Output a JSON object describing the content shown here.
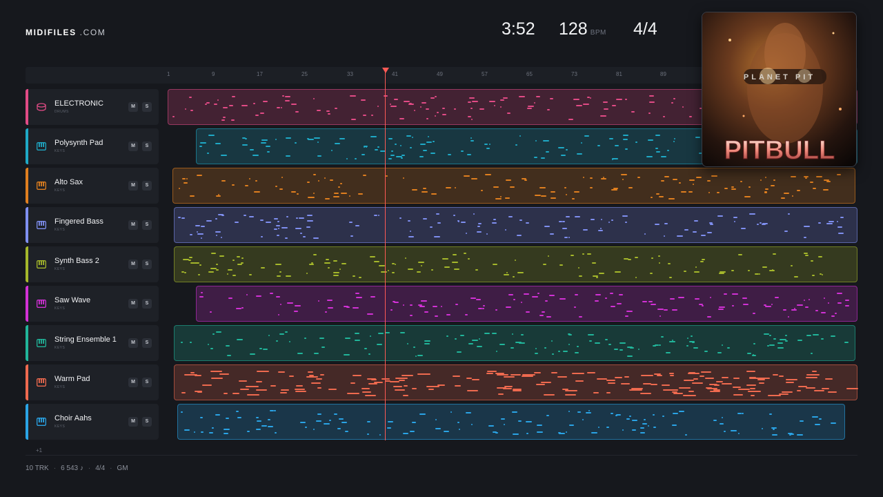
{
  "brand": {
    "name": "MIDIFILES",
    "suffix": ".COM"
  },
  "header": {
    "duration": "3:52",
    "tempo": "128",
    "tempo_unit": "BPM",
    "time_signature": "4/4"
  },
  "album": {
    "artist_text": "PITBULL",
    "album_text": "PLANET PIT"
  },
  "ruler": {
    "ticks": [
      "1",
      "9",
      "17",
      "25",
      "33",
      "41",
      "49",
      "57",
      "65",
      "73",
      "81",
      "89"
    ]
  },
  "colors": {
    "pink": "#e24b86",
    "cyan": "#1fa9c6",
    "orange": "#e07f1f",
    "periwinkle": "#7f8ff0",
    "olive": "#a5b82b",
    "magenta": "#d231d6",
    "teal": "#21b59a",
    "coral": "#ef6a4f",
    "blue": "#2aa4e6",
    "playhead": "#ff5a55"
  },
  "tracks": [
    {
      "name": "ELECTRONIC",
      "type": "DRUMS",
      "icon": "drum-icon",
      "color": "#e24b86"
    },
    {
      "name": "Polysynth Pad",
      "type": "KEYS",
      "icon": "keyboard-icon",
      "color": "#1fa9c6"
    },
    {
      "name": "Alto Sax",
      "type": "KEYS",
      "icon": "keyboard-icon",
      "color": "#e07f1f"
    },
    {
      "name": "Fingered Bass",
      "type": "KEYS",
      "icon": "keyboard-icon",
      "color": "#7f8ff0"
    },
    {
      "name": "Synth Bass 2",
      "type": "KEYS",
      "icon": "keyboard-icon",
      "color": "#a5b82b"
    },
    {
      "name": "Saw Wave",
      "type": "KEYS",
      "icon": "keyboard-icon",
      "color": "#d231d6"
    },
    {
      "name": "String Ensemble 1",
      "type": "KEYS",
      "icon": "keyboard-icon",
      "color": "#21b59a"
    },
    {
      "name": "Warm Pad",
      "type": "KEYS",
      "icon": "keyboard-icon",
      "color": "#ef6a4f"
    },
    {
      "name": "Choir Aahs",
      "type": "KEYS",
      "icon": "keyboard-icon",
      "color": "#2aa4e6"
    }
  ],
  "track_buttons": {
    "mute": "M",
    "solo": "S"
  },
  "more_tracks": "+1",
  "footer": {
    "tracks": "10 TRK",
    "notes": "6 543 ♪",
    "time_signature": "4/4",
    "standard": "GM"
  }
}
